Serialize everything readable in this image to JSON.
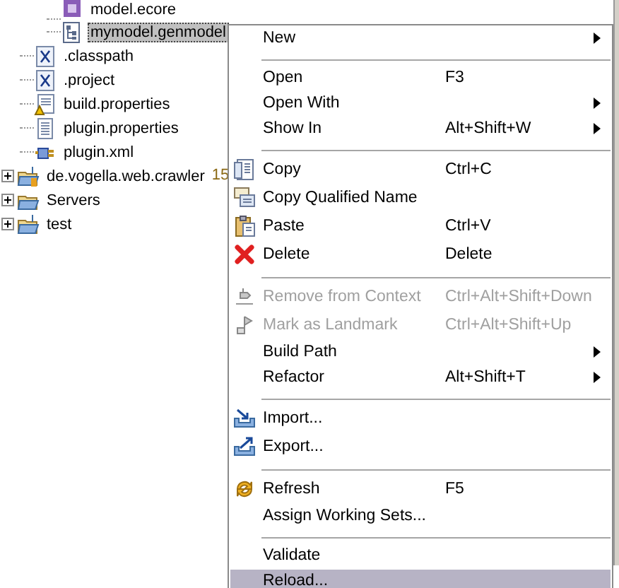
{
  "tree": [
    {
      "children": [
        {
          "children": [
            {
              "label": "model.ecore",
              "selected": false
            },
            {
              "label": "mymodel.genmodel",
              "selected": true
            }
          ]
        },
        {
          "label": ".classpath",
          "selected": false
        },
        {
          "label": ".project",
          "selected": false
        },
        {
          "label": "build.properties",
          "selected": false
        },
        {
          "label": "plugin.properties",
          "selected": false
        },
        {
          "label": "plugin.xml",
          "selected": false
        }
      ]
    },
    {
      "label": "de.vogella.web.crawler",
      "decoration": "15",
      "selected": false,
      "expanded": false
    },
    {
      "label": "Servers",
      "selected": false,
      "expanded": false
    },
    {
      "label": "test",
      "selected": false,
      "expanded": false
    }
  ],
  "context_menu": {
    "items": [
      {
        "kind": "item",
        "label": "New",
        "submenu": true,
        "disabled": false,
        "selected": false
      },
      {
        "kind": "separator"
      },
      {
        "kind": "item",
        "label": "Open",
        "shortcut": "F3",
        "disabled": false,
        "selected": false
      },
      {
        "kind": "item",
        "label": "Open With",
        "submenu": true,
        "disabled": false,
        "selected": false
      },
      {
        "kind": "item",
        "label": "Show In",
        "shortcut": "Alt+Shift+W",
        "submenu": true,
        "disabled": false,
        "selected": false
      },
      {
        "kind": "separator"
      },
      {
        "kind": "item",
        "label": "Copy",
        "shortcut": "Ctrl+C",
        "disabled": false,
        "selected": false
      },
      {
        "kind": "item",
        "label": "Copy Qualified Name",
        "disabled": false,
        "selected": false
      },
      {
        "kind": "item",
        "label": "Paste",
        "shortcut": "Ctrl+V",
        "disabled": false,
        "selected": false
      },
      {
        "kind": "item",
        "label": "Delete",
        "shortcut": "Delete",
        "disabled": false,
        "selected": false
      },
      {
        "kind": "separator"
      },
      {
        "kind": "item",
        "label": "Remove from Context",
        "shortcut": "Ctrl+Alt+Shift+Down",
        "disabled": true,
        "selected": false
      },
      {
        "kind": "item",
        "label": "Mark as Landmark",
        "shortcut": "Ctrl+Alt+Shift+Up",
        "disabled": true,
        "selected": false
      },
      {
        "kind": "item",
        "label": "Build Path",
        "submenu": true,
        "disabled": false,
        "selected": false
      },
      {
        "kind": "item",
        "label": "Refactor",
        "shortcut": "Alt+Shift+T",
        "submenu": true,
        "disabled": false,
        "selected": false
      },
      {
        "kind": "separator"
      },
      {
        "kind": "item",
        "label": "Import...",
        "disabled": false,
        "selected": false
      },
      {
        "kind": "item",
        "label": "Export...",
        "disabled": false,
        "selected": false
      },
      {
        "kind": "separator"
      },
      {
        "kind": "item",
        "label": "Refresh",
        "shortcut": "F5",
        "disabled": false,
        "selected": false
      },
      {
        "kind": "item",
        "label": "Assign Working Sets...",
        "disabled": false,
        "selected": false
      },
      {
        "kind": "separator"
      },
      {
        "kind": "item",
        "label": "Validate",
        "disabled": false,
        "selected": false
      },
      {
        "kind": "item",
        "label": "Reload...",
        "disabled": false,
        "selected": true
      }
    ]
  }
}
